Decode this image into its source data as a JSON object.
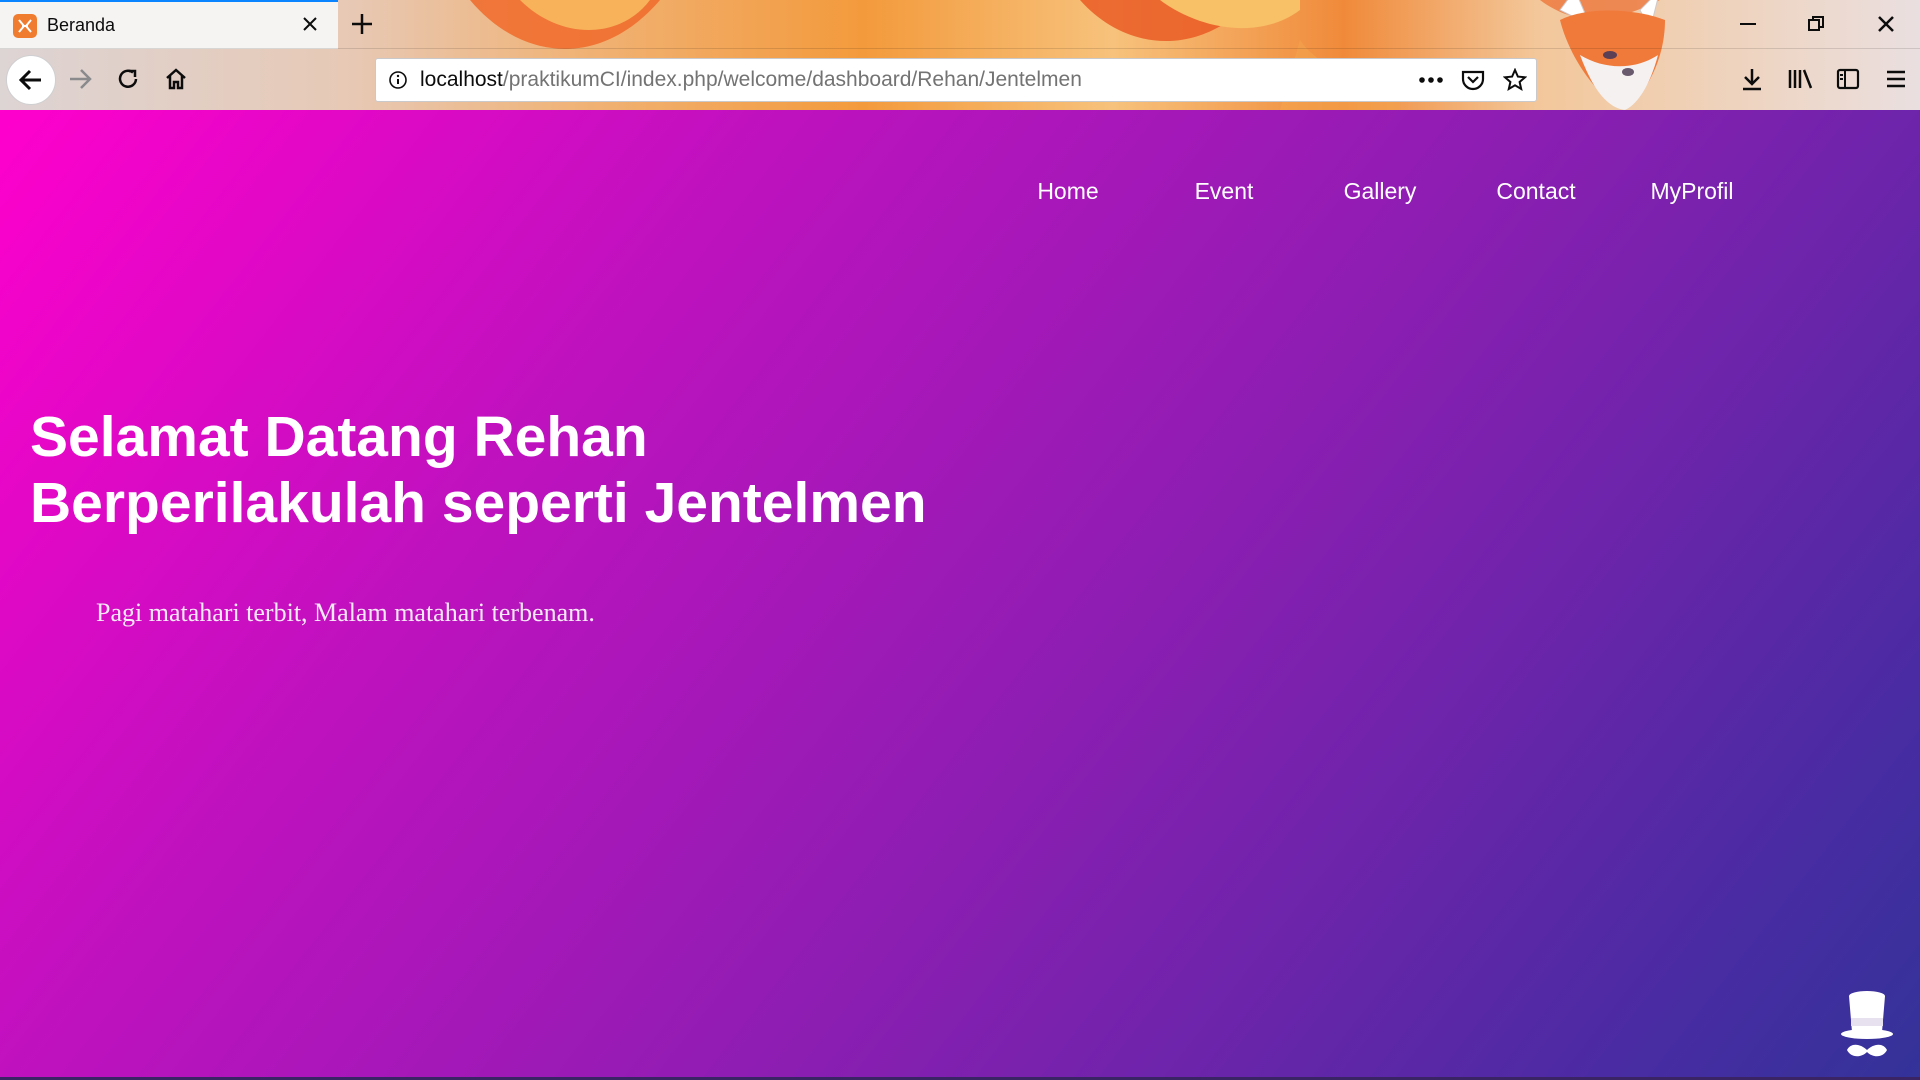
{
  "browser": {
    "tab": {
      "title": "Beranda",
      "favicon": "xampp-icon"
    },
    "url": {
      "host": "localhost",
      "path": "/praktikumCI/index.php/welcome/dashboard/Rehan/Jentelmen"
    },
    "icons": {
      "back": "back-arrow-icon",
      "forward": "forward-arrow-icon",
      "reload": "reload-icon",
      "home": "home-icon",
      "info": "info-icon",
      "page_actions": "more-horizontal-icon",
      "pocket": "pocket-icon",
      "bookmark": "star-icon",
      "downloads": "download-icon",
      "library": "library-icon",
      "sidebar": "sidebar-icon",
      "menu": "hamburger-menu-icon",
      "minimize": "minimize-icon",
      "restore": "restore-icon",
      "close": "close-icon",
      "new_tab": "plus-icon"
    },
    "accent_color": "#0a84ff"
  },
  "page": {
    "nav": [
      "Home",
      "Event",
      "Gallery",
      "Contact",
      "MyProfil"
    ],
    "hero": {
      "title_line1": "Selamat Datang Rehan",
      "title_line2": "Berperilakulah seperti Jentelmen",
      "subtitle": "Pagi matahari terbit, Malam matahari terbenam."
    },
    "gradient": {
      "start": "#ff00cc",
      "end": "#333399"
    },
    "corner_icon": "top-hat-mustache-icon"
  }
}
